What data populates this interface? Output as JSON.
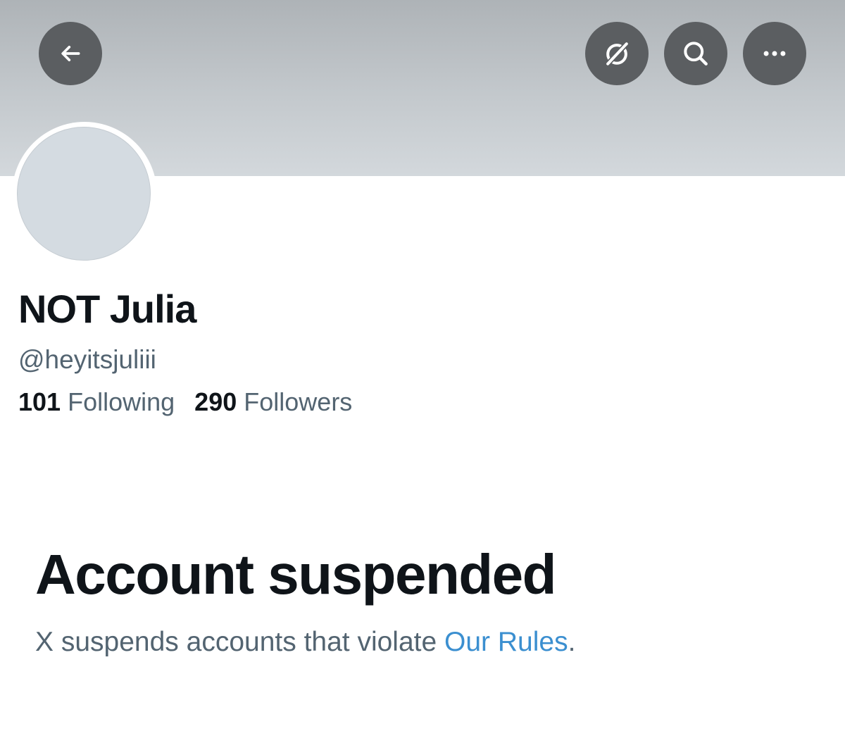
{
  "header": {
    "back_icon": "arrow-left-icon",
    "grok_icon": "grok-icon",
    "search_icon": "search-icon",
    "more_icon": "more-horizontal-icon"
  },
  "profile": {
    "display_name": "NOT Julia",
    "handle": "@heyitsjuliii",
    "following_count": "101",
    "following_label": "Following",
    "followers_count": "290",
    "followers_label": "Followers"
  },
  "suspension": {
    "title": "Account suspended",
    "message": "X suspends accounts that violate ",
    "link_text": "Our Rules",
    "trailing": "."
  },
  "colors": {
    "text_primary": "#0f1419",
    "text_secondary": "#536471",
    "link": "#3b8fd0",
    "button_bg": "#5b5e61",
    "avatar_bg": "#d4dbe1"
  }
}
